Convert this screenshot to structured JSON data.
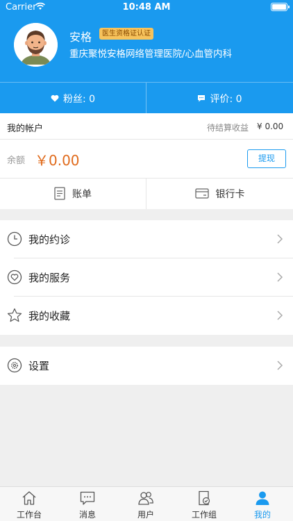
{
  "status_bar": {
    "carrier": "Carrier",
    "time": "10:48 AM"
  },
  "profile": {
    "name": "安格",
    "cert_badge": "医生资格证认证",
    "hospital": "重庆聚悦安格网络管理医院/心血管内科"
  },
  "stats": {
    "fans_label": "粉丝: 0",
    "reviews_label": "评价: 0"
  },
  "account": {
    "title": "我的帐户",
    "pending_label": "待结算收益",
    "pending_value": "¥ 0.00",
    "balance_label": "余额",
    "balance_value": "￥0.00",
    "withdraw_label": "提现",
    "bill_label": "账单",
    "bank_card_label": "银行卡"
  },
  "menu": {
    "appointments": "我的约诊",
    "services": "我的服务",
    "favorites": "我的收藏",
    "settings": "设置"
  },
  "tabbar": {
    "workbench": "工作台",
    "messages": "消息",
    "users": "用户",
    "workgroup": "工作组",
    "mine": "我的"
  },
  "colors": {
    "brand_blue": "#1a9aef",
    "balance_orange": "#e06a1b",
    "badge_yellow": "#f7c35c"
  }
}
